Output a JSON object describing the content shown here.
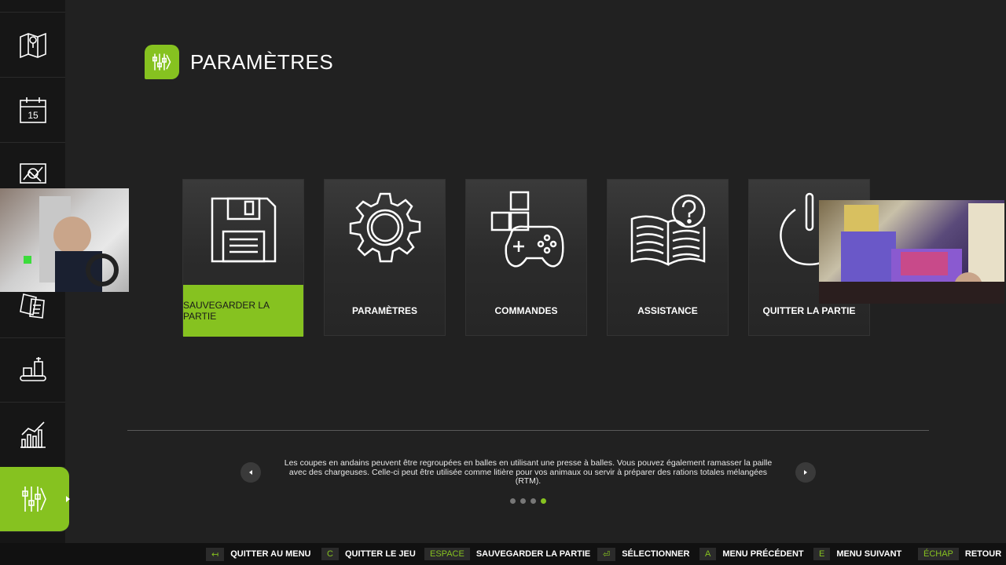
{
  "sidebar": {
    "items": [
      {
        "icon": "map-icon"
      },
      {
        "icon": "calendar-icon",
        "badge": "15"
      },
      {
        "icon": "price-chart-icon"
      },
      {
        "icon": "documents-icon"
      },
      {
        "icon": "production-icon"
      },
      {
        "icon": "statistics-icon"
      },
      {
        "icon": "settings-sliders-icon",
        "active": true
      }
    ]
  },
  "header": {
    "title": "PARAMÈTRES"
  },
  "tiles": [
    {
      "label": "SAUVEGARDER LA PARTIE",
      "icon": "floppy-disk-icon",
      "selected": true
    },
    {
      "label": "PARAMÈTRES",
      "icon": "gear-icon"
    },
    {
      "label": "COMMANDES",
      "icon": "controls-gamepad-icon"
    },
    {
      "label": "ASSISTANCE",
      "icon": "help-book-icon"
    },
    {
      "label": "QUITTER LA PARTIE",
      "icon": "power-icon"
    }
  ],
  "tip": {
    "text": "Les coupes en andains peuvent être regroupées en balles en utilisant une presse à balles. Vous pouvez également ramasser la paille avec des chargeuses. Celle-ci peut être utilisée comme litière pour vos animaux ou servir à préparer des rations totales mélangées (RTM).",
    "pages": 4,
    "current_page": 4
  },
  "bottom_hints": [
    {
      "key": "↤",
      "label": "QUITTER AU MENU"
    },
    {
      "key": "C",
      "label": "QUITTER LE JEU"
    },
    {
      "key": "ESPACE",
      "label": "SAUVEGARDER LA PARTIE"
    },
    {
      "key": "⏎",
      "label": "SÉLECTIONNER"
    },
    {
      "key": "A",
      "label": "MENU PRÉCÉDENT"
    },
    {
      "key": "E",
      "label": "MENU SUIVANT"
    },
    {
      "key": "ÉCHAP",
      "label": "RETOUR"
    }
  ],
  "colors": {
    "accent": "#86c220",
    "background": "#212121",
    "sidebar": "#161616"
  }
}
